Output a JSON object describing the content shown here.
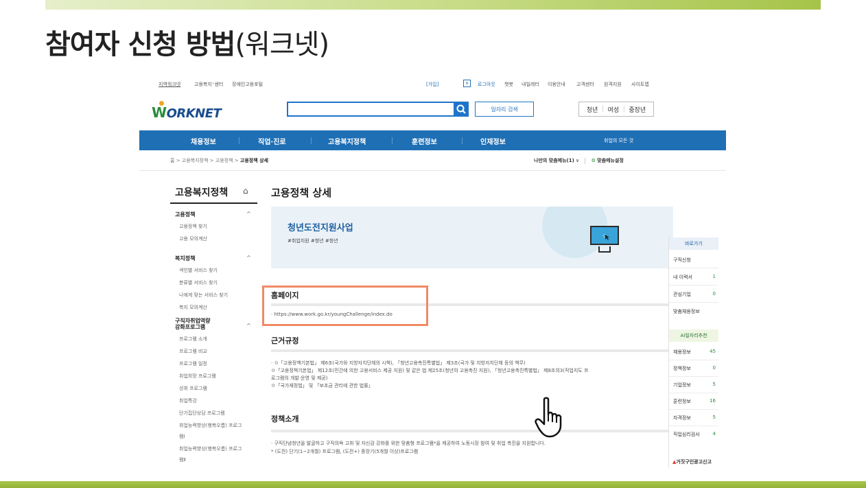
{
  "slide": {
    "title_bold": "참여자 신청 방법",
    "title_rest": "(워크넷)"
  },
  "utility": {
    "left": [
      "지역워크넷",
      "고용복지⁺센터",
      "장애인고용포털"
    ],
    "join": "[가입]",
    "right": [
      "로그아웃",
      "챗봇",
      "내일레터",
      "이용안내",
      "고객센터",
      "원격지원",
      "사이트맵"
    ]
  },
  "header": {
    "logo": "ORKNET",
    "logo_w": "W",
    "search_placeholder": "",
    "job_search": "일자리 검색",
    "audience": [
      "청년",
      "여성",
      "중장년"
    ]
  },
  "nav": {
    "items": [
      "채용정보",
      "직업·진로",
      "고용복지정책",
      "훈련정보",
      "인재정보"
    ],
    "right": "취업의 모든 것"
  },
  "breadcrumb": {
    "home": "홈",
    "sep": ">",
    "items": [
      "고용복지정책",
      "고용정책"
    ],
    "current": "고용정책 상세"
  },
  "menu": {
    "my_menu": "나만의 맞춤메뉴(1)",
    "settings": "맞춤메뉴설정"
  },
  "sidebar": {
    "title": "고용복지정책",
    "sections": [
      {
        "label": "고용정책",
        "items": [
          "고용정책 찾기",
          "고용 모의계산"
        ]
      },
      {
        "label": "복지정책",
        "items": [
          "색인별 서비스 찾기",
          "분류별 서비스 찾기",
          "나에게 맞는 서비스 찾기",
          "복지 모의계산"
        ]
      },
      {
        "label": "구직자취업역량\n강화프로그램",
        "items": [
          "프로그램 소개",
          "프로그램 비교",
          "프로그램 일정",
          "취업희망 프로그램",
          "성취 프로그램",
          "취업특강",
          "단기집단상담 프로그램",
          "취업능력향상(행복오름) 프로그램Ⅰ",
          "취업능력향상(행복오름) 프로그램Ⅱ"
        ]
      }
    ],
    "section3_line1": "구직자취업역량",
    "section3_line2": "강화프로그램",
    "items3_wrap": [
      [
        "프로그램 소개"
      ],
      [
        "프로그램 비교"
      ],
      [
        "프로그램 일정"
      ],
      [
        "취업희망 프로그램"
      ],
      [
        "성취 프로그램"
      ],
      [
        "취업특강"
      ],
      [
        "단기집단상담 프로그램"
      ],
      [
        "취업능력향상(행복오름) 프로그",
        "램Ⅰ"
      ],
      [
        "취업능력향상(행복오름) 프로그",
        "램Ⅱ"
      ]
    ]
  },
  "main": {
    "title": "고용정책 상세",
    "program": {
      "name": "청년도전지원사업",
      "tags": "#취업지원 #청년 #청년"
    },
    "homepage": {
      "heading": "홈페이지",
      "url": "· https://www.work.go.kr/youngChallenge/index.do"
    },
    "basis": {
      "heading": "근거규정",
      "lines": [
        "· ㅇ「고용정책기본법」 제6조(국가와 지방자치단체의 시책), 「청년고용촉진특별법」 제3조(국가 및 지방자치단체 등의 책무)",
        "  ㅇ「고용정책기본법」 제12조(민간에 의한 고용서비스 제공 지원) 및 같은 법 제25조(청년의 고용촉진 지원), 「청년고용촉진특별법」 제8조의3(직업지도 프",
        "  로그램의 개발·운영 및 제공)",
        "  ㅇ「국가재정법」 및 「보조금 관리에 관한 법률」"
      ]
    },
    "intro": {
      "heading": "정책소개",
      "lines": [
        "· 구직단념청년을 발굴하고 구직의욕 고취 및 자신감 강화를 위한 맞춤형 프로그램*을 제공하여 노동시장 참여 및 취업 촉진을 지원합니다.",
        "  * (도전) 단기(1~2개월) 프로그램, (도전+) 중장기(5개월 이상)프로그램"
      ]
    }
  },
  "quick": {
    "title": "바로가기",
    "rows": [
      {
        "label": "구직신청",
        "value": ""
      },
      {
        "label": "내 이력서",
        "value": "1"
      },
      {
        "label": "관심기업",
        "value": "0"
      },
      {
        "label": "맞춤채용정보",
        "value": ""
      }
    ],
    "ai_title": "AI일자리추천",
    "ai_rows": [
      {
        "label": "채용정보",
        "value": "45"
      },
      {
        "label": "정책정보",
        "value": "0"
      },
      {
        "label": "기업정보",
        "value": "5"
      },
      {
        "label": "훈련정보",
        "value": "16"
      },
      {
        "label": "자격정보",
        "value": "5"
      },
      {
        "label": "직업심리검사",
        "value": "4"
      }
    ],
    "report": "거짓구인광고신고"
  },
  "colors": {
    "nav": "#1f6fb4",
    "accent_green": "#a6c449",
    "highlight": "#f08966"
  }
}
